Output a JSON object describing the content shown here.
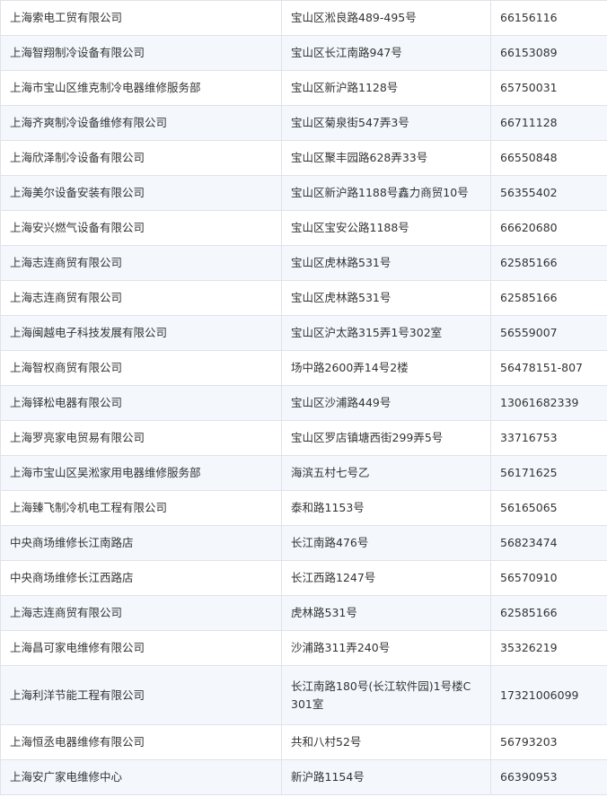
{
  "rows": [
    {
      "name": "上海索电工贸有限公司",
      "address": "宝山区淞良路489-495号",
      "phone": "66156116"
    },
    {
      "name": "上海智翔制冷设备有限公司",
      "address": "宝山区长江南路947号",
      "phone": "66153089"
    },
    {
      "name": "上海市宝山区维克制冷电器维修服务部",
      "address": "宝山区新沪路1128号",
      "phone": "65750031"
    },
    {
      "name": "上海齐爽制冷设备维修有限公司",
      "address": "宝山区菊泉街547弄3号",
      "phone": "66711128"
    },
    {
      "name": "上海欣泽制冷设备有限公司",
      "address": "宝山区聚丰园路628弄33号",
      "phone": "66550848"
    },
    {
      "name": "上海美尔设备安装有限公司",
      "address": "宝山区新沪路1188号鑫力商贸10号",
      "phone": "56355402"
    },
    {
      "name": "上海安兴燃气设备有限公司",
      "address": "宝山区宝安公路1188号",
      "phone": "66620680"
    },
    {
      "name": "上海志连商贸有限公司",
      "address": "宝山区虎林路531号",
      "phone": "62585166"
    },
    {
      "name": "上海志连商贸有限公司",
      "address": "宝山区虎林路531号",
      "phone": "62585166"
    },
    {
      "name": "上海闽越电子科技发展有限公司",
      "address": "宝山区沪太路315弄1号302室",
      "phone": "56559007"
    },
    {
      "name": "上海智权商贸有限公司",
      "address": "场中路2600弄14号2楼",
      "phone": "56478151-807"
    },
    {
      "name": "上海铎松电器有限公司",
      "address": "宝山区沙浦路449号",
      "phone": "13061682339"
    },
    {
      "name": "上海罗亮家电贸易有限公司",
      "address": "宝山区罗店镇塘西街299弄5号",
      "phone": "33716753"
    },
    {
      "name": "上海市宝山区吴淞家用电器维修服务部",
      "address": "海滨五村七号乙",
      "phone": "56171625"
    },
    {
      "name": "上海臻飞制冷机电工程有限公司",
      "address": "泰和路1153号",
      "phone": "56165065"
    },
    {
      "name": "中央商场维修长江南路店",
      "address": "长江南路476号",
      "phone": "56823474"
    },
    {
      "name": "中央商场维修长江西路店",
      "address": "长江西路1247号",
      "phone": "56570910"
    },
    {
      "name": "上海志连商贸有限公司",
      "address": "虎林路531号",
      "phone": "62585166"
    },
    {
      "name": "上海昌可家电维修有限公司",
      "address": "沙浦路311弄240号",
      "phone": "35326219"
    },
    {
      "name": "上海利洋节能工程有限公司",
      "address": "长江南路180号(长江软件园)1号楼C301室",
      "phone": "17321006099"
    },
    {
      "name": "上海恒丞电器维修有限公司",
      "address": "共和八村52号",
      "phone": "56793203"
    },
    {
      "name": "上海安广家电维修中心",
      "address": "新沪路1154号",
      "phone": "66390953"
    }
  ]
}
